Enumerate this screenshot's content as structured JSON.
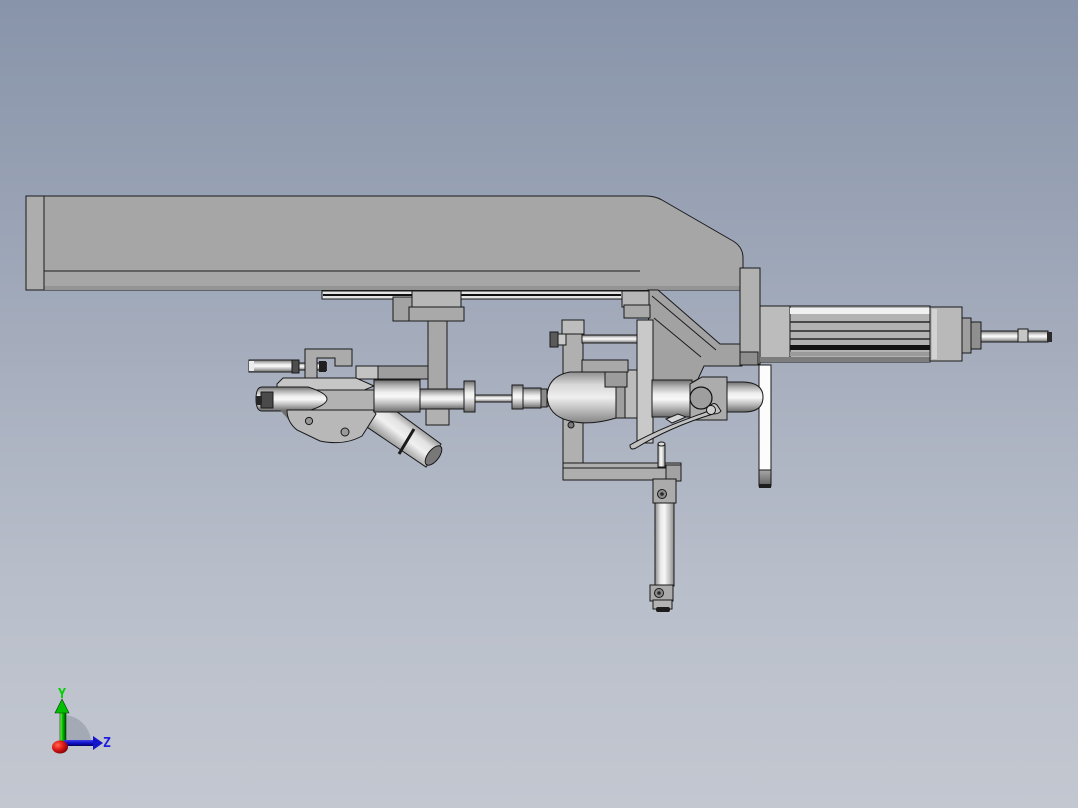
{
  "viewport": {
    "axis_triad": {
      "y_label": "Y",
      "z_label": "Z",
      "y_color": "#00d000",
      "z_color": "#1e1ee0",
      "x_origin_color": "#d01818"
    },
    "background": {
      "top": "#8894aa",
      "bottom": "#c3c7d0"
    },
    "model_color": "#a6a6a6"
  }
}
